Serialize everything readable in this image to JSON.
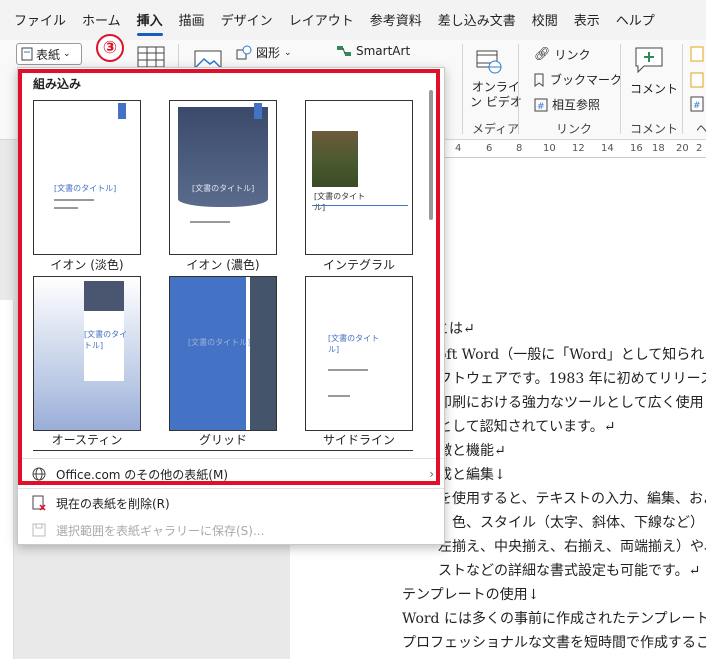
{
  "menu": {
    "items": [
      "ファイル",
      "ホーム",
      "挿入",
      "描画",
      "デザイン",
      "レイアウト",
      "参考資料",
      "差し込み文書",
      "校閲",
      "表示",
      "ヘルプ"
    ]
  },
  "ribbon": {
    "cover_label": "表紙",
    "step_number": "③",
    "shapes_label": "図形",
    "smartart_label": "SmartArt",
    "online_video_line1": "オンライ",
    "online_video_line2": "ン ビデオ",
    "link_label": "リンク",
    "bookmark_label": "ブックマーク",
    "crossref_label": "相互参照",
    "comment_label": "コメント",
    "group_media": "メディア",
    "group_link": "リンク",
    "group_comment": "コメント",
    "group_partial": "ヘ"
  },
  "ruler": {
    "numbers": [
      "4",
      "6",
      "8",
      "10",
      "12",
      "14",
      "16",
      "18",
      "20",
      "2"
    ]
  },
  "dropdown": {
    "section_header": "組み込み",
    "covers": [
      {
        "label": "イオン (淡色)",
        "title": "[文書のタイトル]"
      },
      {
        "label": "イオン (濃色)",
        "title": "[文書のタイトル]"
      },
      {
        "label": "インテグラル",
        "title": "[文書のタイトル]"
      },
      {
        "label": "オースティン",
        "title": "[文書のタイトル]"
      },
      {
        "label": "グリッド",
        "title": "[文書のタイトル]"
      },
      {
        "label": "サイドライン",
        "title": "[文書のタイトル]"
      }
    ],
    "more_covers": "Office.com のその他の表紙(M)",
    "remove_cover": "現在の表紙を削除(R)",
    "save_selection": "選択範囲を表紙ギャラリーに保存(S)..."
  },
  "document": {
    "lines": [
      "とは↵",
      "oft Word（一般に「Word」として知られる",
      "フトウェアです。1983 年に初めてリリース",
      "印刷における強力なツールとして広く使用",
      "として認知されています。↵",
      "徴と機能↵",
      "成と編集↓",
      "を使用すると、テキストの入力、編集、およ",
      "、色、スタイル（太字、斜体、下線など）",
      "左揃え、中央揃え、右揃え、両端揃え）や、",
      "ストなどの詳細な書式設定も可能です。↵",
      "テンプレートの使用↓",
      "Word には多くの事前に作成されたテンプレート",
      "プロフェッショナルな文書を短時間で作成するこ"
    ]
  },
  "colors": {
    "accent": "#185abd",
    "highlight": "#e0102a"
  }
}
